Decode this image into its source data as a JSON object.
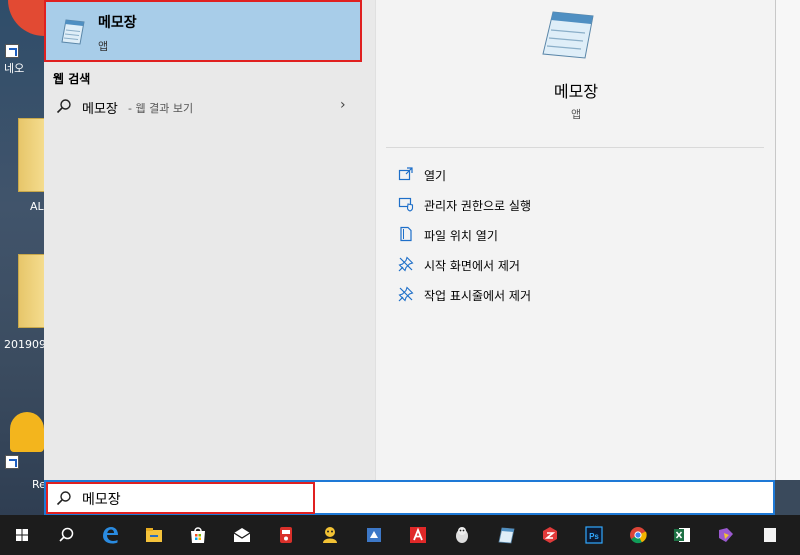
{
  "desktop": {
    "labels": [
      "네오",
      "AL",
      "201909",
      "Re"
    ]
  },
  "best_match": {
    "title": "메모장",
    "subtitle": "앱"
  },
  "web_section": {
    "title": "웹 검색",
    "query": "메모장",
    "suffix": "- 웹 결과 보기",
    "chevron": "›"
  },
  "details": {
    "title": "메모장",
    "subtitle": "앱",
    "actions": [
      {
        "label": "열기",
        "icon": "open-icon"
      },
      {
        "label": "관리자 권한으로 실행",
        "icon": "admin-run-icon"
      },
      {
        "label": "파일 위치 열기",
        "icon": "file-location-icon"
      },
      {
        "label": "시작 화면에서 제거",
        "icon": "unpin-start-icon"
      },
      {
        "label": "작업 표시줄에서 제거",
        "icon": "unpin-taskbar-icon"
      }
    ]
  },
  "search": {
    "value": "메모장"
  },
  "taskbar": {
    "items": [
      "windows-start-icon",
      "search-icon",
      "edge-icon",
      "file-explorer-icon",
      "store-icon",
      "mail-icon",
      "app-red-icon",
      "app-yellow-icon",
      "app-blue-icon",
      "acrobat-icon",
      "app-penguin-icon",
      "notepad-icon",
      "app-red2-icon",
      "photoshop-icon",
      "chrome-icon",
      "excel-icon",
      "app-purple-icon",
      "app-white-icon"
    ]
  },
  "colors": {
    "selection": "#a8cde9",
    "highlight_border": "#e02020",
    "search_border": "#1e79d6",
    "taskbar": "#1c1c1c"
  }
}
